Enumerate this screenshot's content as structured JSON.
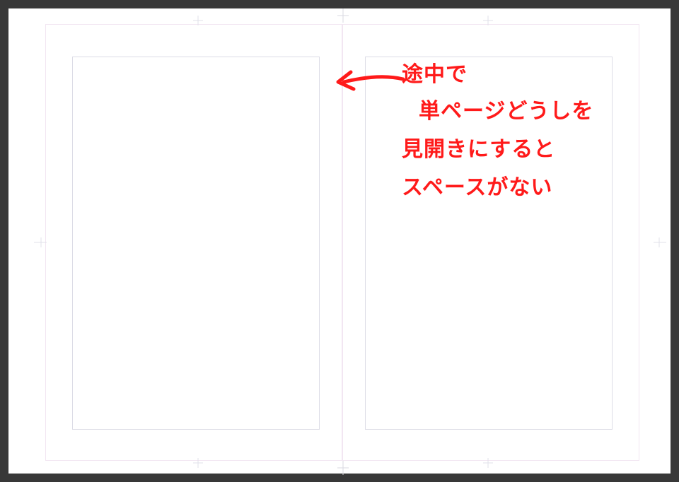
{
  "canvas": {
    "guides": {
      "outer_left": "bleed-guide-left",
      "outer_right": "bleed-guide-right",
      "inner_left": "margin-guide-left",
      "inner_right": "margin-guide-right"
    },
    "registration_marks": [
      "top-left-crop-mark",
      "top-center-crop-mark",
      "top-right-crop-mark",
      "mid-left-crop-mark",
      "mid-right-crop-mark",
      "bottom-left-crop-mark",
      "bottom-center-crop-mark",
      "bottom-right-crop-mark"
    ]
  },
  "annotation": {
    "arrow": "←",
    "line1": "途中で",
    "line2": "単ページどうしを",
    "line3": "見開きにすると",
    "line4": "スペースがない"
  },
  "colors": {
    "background": "#383838",
    "paper": "#ffffff",
    "guide_outer": "#f2e6f2",
    "guide_inner": "#dcdce6",
    "annotation": "#ff1a1a"
  }
}
